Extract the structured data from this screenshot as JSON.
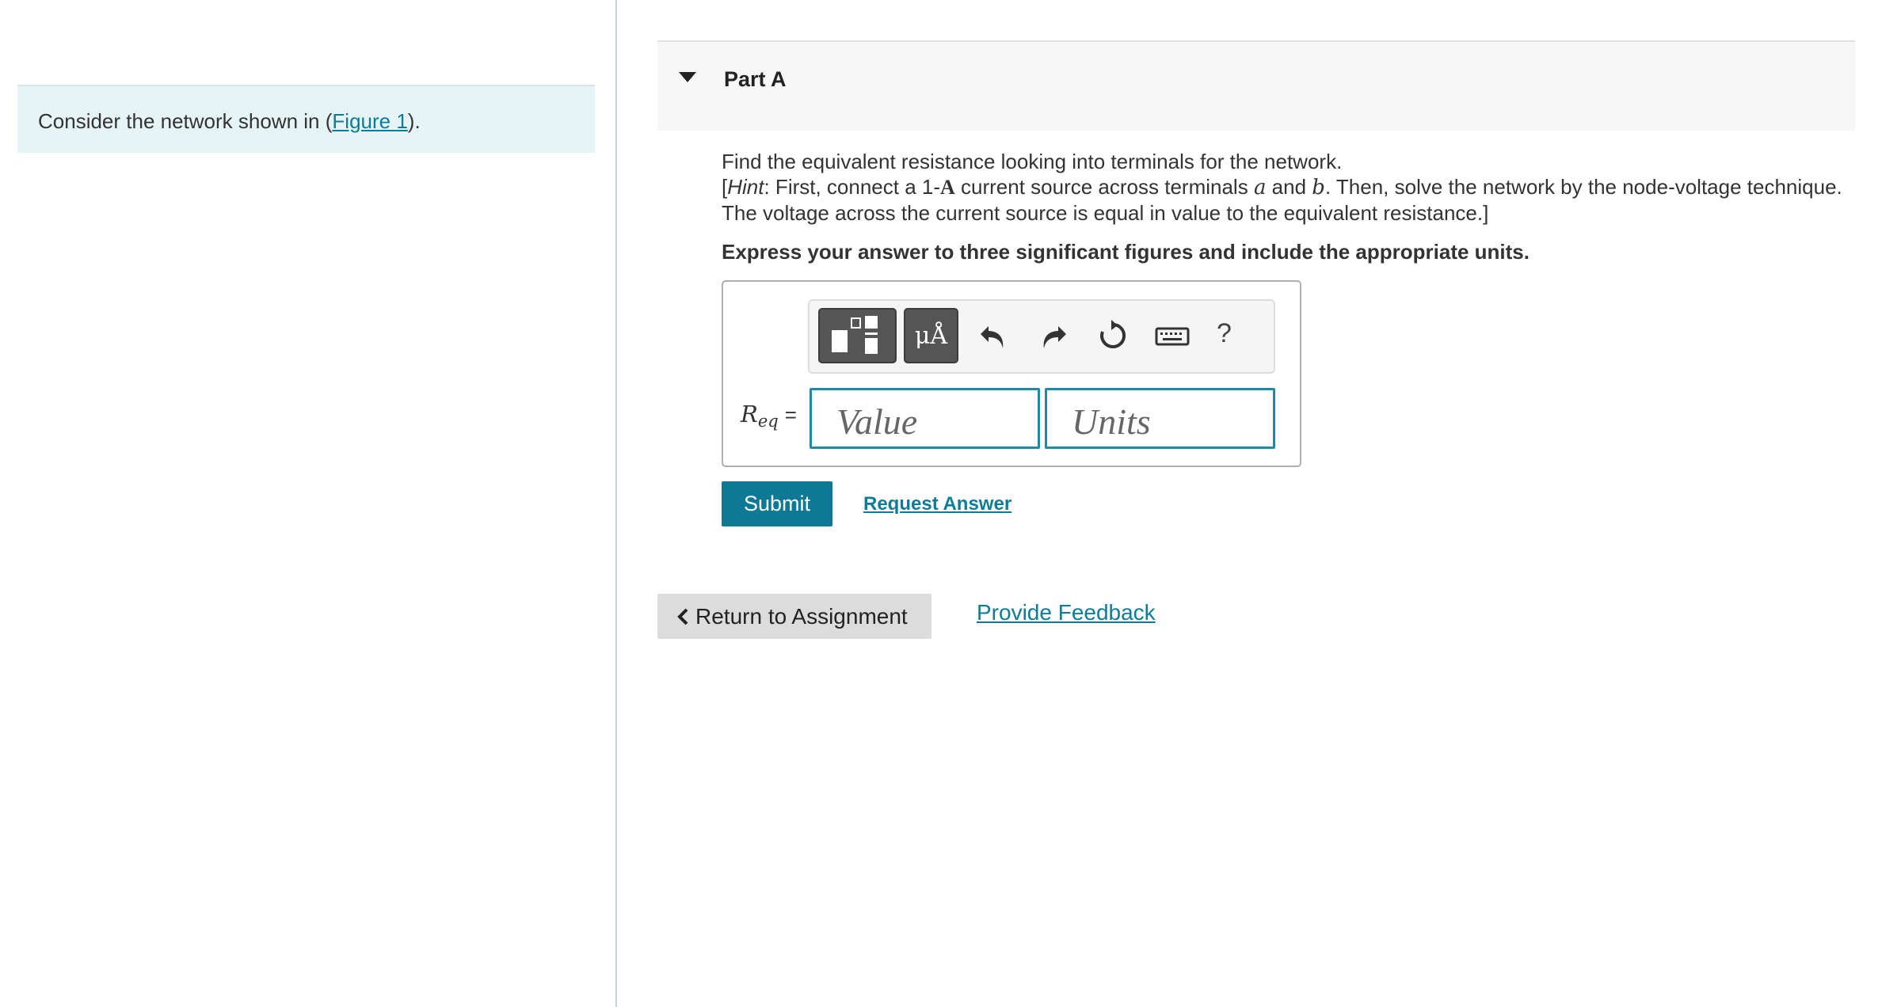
{
  "intro": {
    "prefix": "Consider the network shown in (",
    "figure_link": "Figure 1",
    "suffix": ")."
  },
  "part": {
    "title": "Part A",
    "question_line1": "Find the equivalent resistance looking into terminals for the network.",
    "hint_open": "[",
    "hint_word": "Hint",
    "hint_1": ": First, connect a 1-",
    "hint_unit": "A",
    "hint_2": " current source across terminals ",
    "hint_var_a": "a",
    "hint_3": " and ",
    "hint_var_b": "b",
    "hint_4": ". Then, solve the network by the node-voltage technique.",
    "question_line3": "The voltage across the current source is equal in value to the equivalent resistance.]",
    "instruction": "Express your answer to three significant figures and include the appropriate units."
  },
  "toolbar": {
    "templates_icon": "templates-icon",
    "units_glyph": "μÅ",
    "undo_icon": "undo-icon",
    "redo_icon": "redo-icon",
    "reset_icon": "reset-icon",
    "keyboard_icon": "keyboard-icon",
    "help_label": "?"
  },
  "answer": {
    "var_main": "R",
    "var_sub": "eq",
    "equals": "=",
    "value_placeholder": "Value",
    "units_placeholder": "Units"
  },
  "actions": {
    "submit": "Submit",
    "request_answer": "Request Answer",
    "return_to_assignment": "Return to Assignment",
    "provide_feedback": "Provide Feedback"
  },
  "colors": {
    "accent": "#0d7995",
    "link": "#0c7c99",
    "intro_bg": "#e6f4f5"
  }
}
